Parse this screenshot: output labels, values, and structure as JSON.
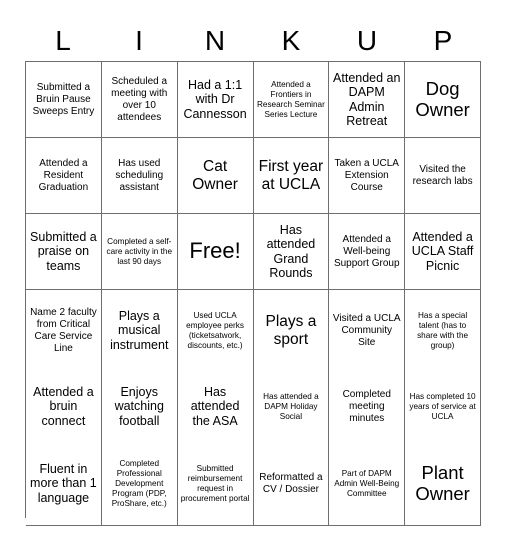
{
  "card": {
    "title_letters": [
      "L",
      "I",
      "N",
      "K",
      "U",
      "P"
    ],
    "free_space_label": "Free!",
    "grid_line_color": "#6e6e6e",
    "background_color": "#ffffff",
    "text_color": "#000000",
    "rows": 6,
    "columns": 6,
    "cells": [
      [
        {
          "text": "Submitted a Bruin Pause Sweeps Entry",
          "size": "sm"
        },
        {
          "text": "Scheduled a meeting with over 10 attendees",
          "size": "sm"
        },
        {
          "text": "Had a 1:1 with Dr Cannesson",
          "size": "md"
        },
        {
          "text": "Attended a Frontiers in Research Seminar Series Lecture",
          "size": "xs"
        },
        {
          "text": "Attended an DAPM Admin Retreat",
          "size": "md"
        },
        {
          "text": "Dog Owner",
          "size": "xl"
        }
      ],
      [
        {
          "text": "Attended a Resident Graduation",
          "size": "sm"
        },
        {
          "text": "Has used scheduling assistant",
          "size": "sm"
        },
        {
          "text": "Cat Owner",
          "size": "lg"
        },
        {
          "text": "First year at UCLA",
          "size": "lg"
        },
        {
          "text": "Taken a UCLA Extension Course",
          "size": "sm"
        },
        {
          "text": "Visited the research labs",
          "size": "sm"
        }
      ],
      [
        {
          "text": "Submitted a praise on teams",
          "size": "md"
        },
        {
          "text": "Completed a self-care activity in the last 90 days",
          "size": "xs"
        },
        {
          "text": "Free!",
          "size": "free"
        },
        {
          "text": "Has attended Grand Rounds",
          "size": "md"
        },
        {
          "text": "Attended a Well-being Support Group",
          "size": "sm"
        },
        {
          "text": "Attended a UCLA Staff Picnic",
          "size": "md"
        }
      ],
      [
        {
          "text": "Name 2 faculty from Critical Care Service Line",
          "size": "sm"
        },
        {
          "text": "Plays a musical instrument",
          "size": "md"
        },
        {
          "text": "Used UCLA employee perks (ticketsatwork, discounts, etc.)",
          "size": "xs"
        },
        {
          "text": "Plays a sport",
          "size": "lg"
        },
        {
          "text": "Visited a UCLA Community Site",
          "size": "sm"
        },
        {
          "text": "Has a special talent (has to share with the group)",
          "size": "xs"
        }
      ],
      [
        {
          "text": "Attended a bruin connect",
          "size": "md"
        },
        {
          "text": "Enjoys watching football",
          "size": "md"
        },
        {
          "text": "Has attended the ASA",
          "size": "md"
        },
        {
          "text": "Has attended a DAPM Holiday Social",
          "size": "xs"
        },
        {
          "text": "Completed meeting minutes",
          "size": "sm"
        },
        {
          "text": "Has completed 10 years of service at UCLA",
          "size": "xs"
        }
      ],
      [
        {
          "text": "Fluent in more than 1 language",
          "size": "md"
        },
        {
          "text": "Completed Professional Development Program (PDP, ProShare, etc.)",
          "size": "xs"
        },
        {
          "text": "Submitted reimbursement request in procurement portal",
          "size": "xs"
        },
        {
          "text": "Reformatted a CV / Dossier",
          "size": "sm"
        },
        {
          "text": "Part of DAPM Admin Well-Being Committee",
          "size": "xs"
        },
        {
          "text": "Plant Owner",
          "size": "xl"
        }
      ]
    ]
  }
}
